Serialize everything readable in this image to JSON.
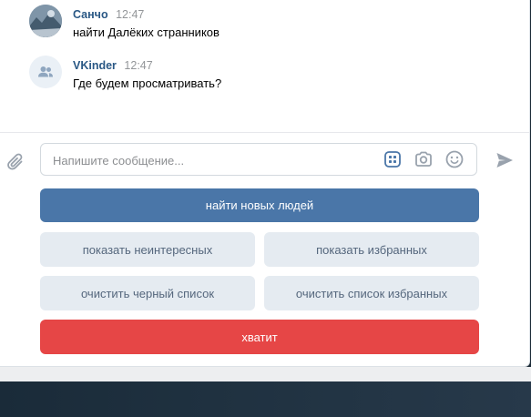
{
  "messages": [
    {
      "author": "Санчо",
      "time": "12:47",
      "text": "найти Далёких странников",
      "avatar_icon": "user-photo"
    },
    {
      "author": "VKinder",
      "time": "12:47",
      "text": "Где будем просматривать?",
      "avatar_icon": "group-icon"
    }
  ],
  "composer": {
    "placeholder": "Напишите сообщение...",
    "icons": [
      "attach-icon",
      "bot-keyboard-icon",
      "camera-icon",
      "emoji-icon",
      "send-icon"
    ]
  },
  "keyboard": {
    "find_new": "найти новых людей",
    "show_uninteresting": "показать неинтересных",
    "show_favorites": "показать избранных",
    "clear_blacklist": "очистить черный список",
    "clear_favorites": "очистить список избранных",
    "stop": "хватит"
  },
  "colors": {
    "primary": "#4a76a8",
    "secondary": "#e5ebf1",
    "negative": "#e64646",
    "author": "#2a5885",
    "icon": "#99a2ad"
  }
}
